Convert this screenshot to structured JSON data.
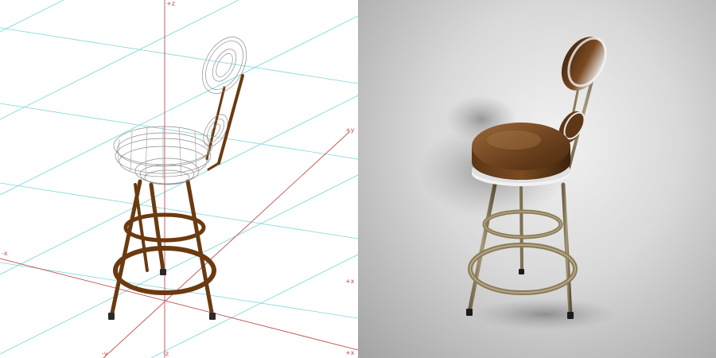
{
  "wireframe_view": {
    "axis_labels": {
      "z_top": "+z",
      "y_pos_right": "+y",
      "x_neg_left": "-x",
      "x_pos_right": "+x",
      "y_neg_bottom": "-y",
      "z_bottom": "-z",
      "x_pos_bottom": "+x"
    },
    "colors": {
      "axis": "#c44d4d",
      "grid": "#7ed6dc",
      "frame": "#6b3a10",
      "seat_mesh": "#9a9a9a"
    }
  },
  "render_view": {
    "colors": {
      "seat_cushion": "#6a3f1c",
      "seat_trim": "#f2f2f2",
      "metal_frame": "#8a7b5a",
      "foot_caps": "#1c1c1c"
    }
  }
}
